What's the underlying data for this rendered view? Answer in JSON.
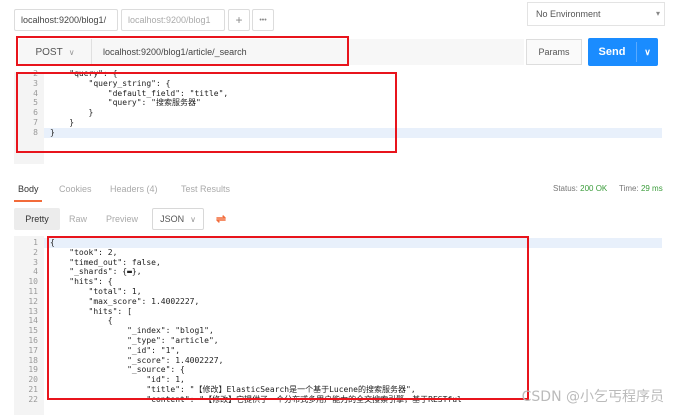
{
  "tabs": {
    "active_label": "localhost:9200/blog1/",
    "inactive_label": "localhost:9200/blog1",
    "add": "+",
    "more": "•••"
  },
  "environment": {
    "label": "No Environment"
  },
  "request": {
    "method": "POST",
    "url": "localhost:9200/blog1/article/_search",
    "params_label": "Params",
    "send_label": "Send"
  },
  "editor": {
    "lines": [
      {
        "n": "2",
        "text": "    \"query\": {"
      },
      {
        "n": "3",
        "text": "        \"query_string\": {"
      },
      {
        "n": "4",
        "text": "            \"default_field\": \"title\","
      },
      {
        "n": "5",
        "text": "            \"query\": \"搜索服务器\""
      },
      {
        "n": "6",
        "text": "        }"
      },
      {
        "n": "7",
        "text": "    }"
      },
      {
        "n": "8",
        "text": "}"
      }
    ]
  },
  "response_tabs": {
    "body": "Body",
    "cookies": "Cookies",
    "headers": "Headers (4)",
    "tests": "Test Results",
    "status_label": "Status:",
    "status_value": "200 OK",
    "time_label": "Time:",
    "time_value": "29 ms"
  },
  "format_bar": {
    "pretty": "Pretty",
    "raw": "Raw",
    "preview": "Preview",
    "json": "JSON"
  },
  "response": {
    "lines": [
      {
        "n": "1",
        "text": "{"
      },
      {
        "n": "2",
        "text": "    \"took\": 2,"
      },
      {
        "n": "3",
        "text": "    \"timed_out\": false,"
      },
      {
        "n": "4",
        "text": "    \"_shards\": {▬},"
      },
      {
        "n": "10",
        "text": "    \"hits\": {"
      },
      {
        "n": "11",
        "text": "        \"total\": 1,"
      },
      {
        "n": "12",
        "text": "        \"max_score\": 1.4002227,"
      },
      {
        "n": "13",
        "text": "        \"hits\": ["
      },
      {
        "n": "14",
        "text": "            {"
      },
      {
        "n": "15",
        "text": "                \"_index\": \"blog1\","
      },
      {
        "n": "16",
        "text": "                \"_type\": \"article\","
      },
      {
        "n": "17",
        "text": "                \"_id\": \"1\","
      },
      {
        "n": "18",
        "text": "                \"_score\": 1.4002227,"
      },
      {
        "n": "19",
        "text": "                \"_source\": {"
      },
      {
        "n": "20",
        "text": "                    \"id\": 1,"
      },
      {
        "n": "21",
        "text": "                    \"title\": \"【修改】ElasticSearch是一个基于Lucene的搜索服务器\","
      },
      {
        "n": "22",
        "text": "                    \"content\": \"【修改】它提供了一个分布式多用户能力的全文搜索引擎，基于RESTful"
      }
    ]
  },
  "watermark": "CSDN @小乞丐程序员"
}
